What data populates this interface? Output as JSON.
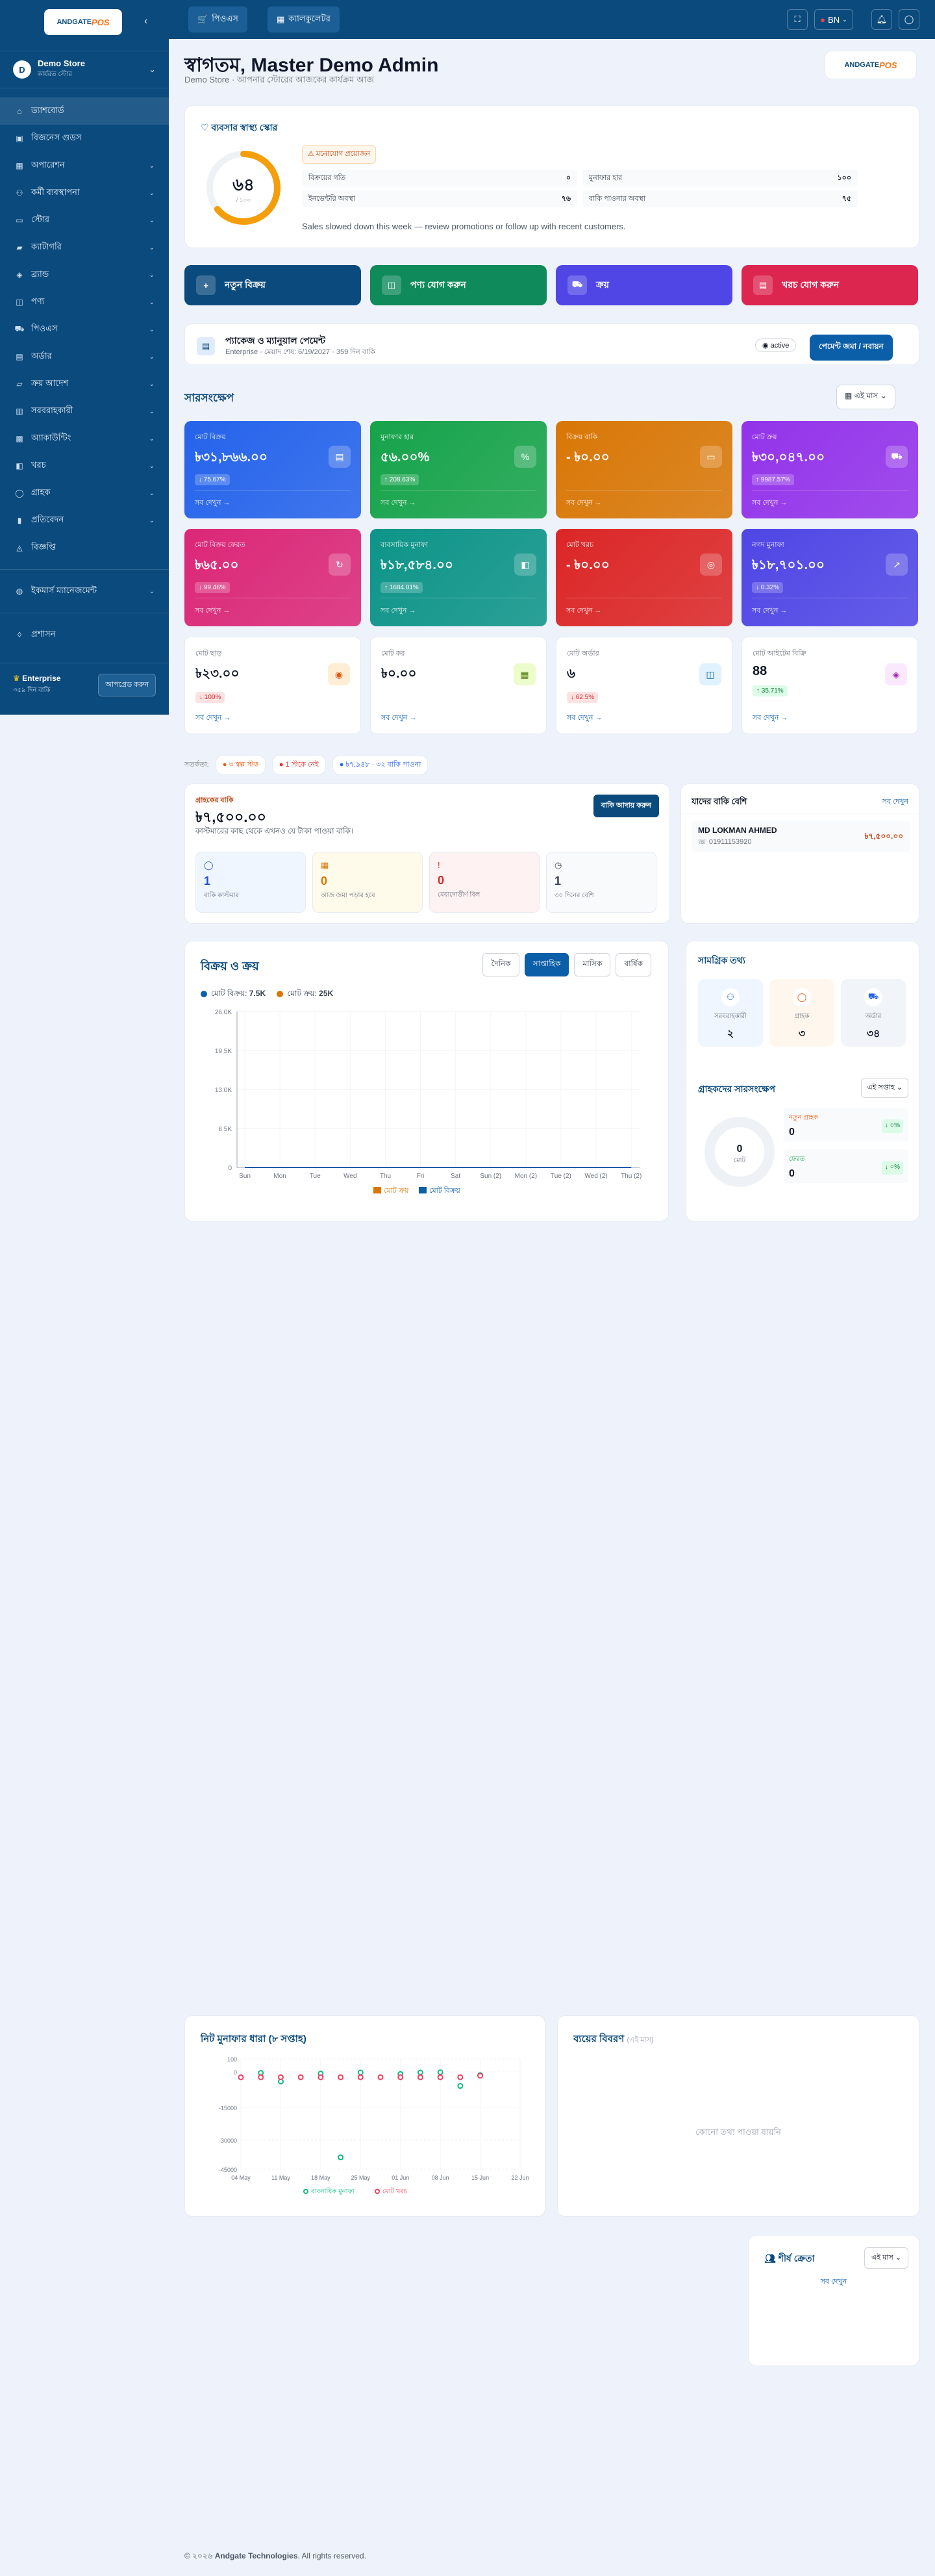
{
  "sidebar": {
    "logo_text": "ANDGATE",
    "logo_pos": "POS",
    "store_initial": "D",
    "store_name": "Demo Store",
    "store_role": "কার্যরত স্টোর",
    "items": [
      {
        "label": "ড্যাশবোর্ড",
        "icon": "home-icon"
      },
      {
        "label": "বিজনেস গুডস",
        "icon": "briefcase-icon"
      },
      {
        "label": "অপারেশন",
        "icon": "grid-icon"
      },
      {
        "label": "কর্মী ব্যবস্থাপনা",
        "icon": "users-icon"
      },
      {
        "label": "স্টোর",
        "icon": "store-icon"
      },
      {
        "label": "ক্যাটাগরি",
        "icon": "folder-icon"
      },
      {
        "label": "ব্র্যান্ড",
        "icon": "tag-icon"
      },
      {
        "label": "পণ্য",
        "icon": "box-icon"
      },
      {
        "label": "পিওএস",
        "icon": "cart-icon"
      },
      {
        "label": "অর্ডার",
        "icon": "receipt-icon"
      },
      {
        "label": "ক্রয় আদেশ",
        "icon": "truck-icon"
      },
      {
        "label": "সরবরাহকারী",
        "icon": "factory-icon"
      },
      {
        "label": "অ্যাকাউন্টিং",
        "icon": "calculator-icon"
      },
      {
        "label": "খরচ",
        "icon": "wallet-icon"
      },
      {
        "label": "গ্রাহক",
        "icon": "user-icon"
      },
      {
        "label": "প্রতিবেদন",
        "icon": "chart-icon"
      },
      {
        "label": "বিজ্ঞপ্তি",
        "icon": "bell-icon"
      },
      {
        "label": "ইকমার্স ম্যানেজমেন্ট",
        "icon": "globe-icon"
      },
      {
        "label": "প্রশাসন",
        "icon": "shield-icon"
      }
    ],
    "enterprise_title": "Enterprise",
    "enterprise_sub": "৩৫৯ দিন বাকি",
    "upgrade_label": "আপগ্রেড করুন"
  },
  "topbar": {
    "pos_label": "পিওএস",
    "calc_label": "ক্যালকুলেটর",
    "lang_label": "BN"
  },
  "header": {
    "welcome": "স্বাগতম, Master Demo Admin",
    "subtitle": "Demo Store · আপনার স্টোরের আজকের কার্যক্রম আজ",
    "brand_text": "ANDGATE",
    "brand_pos": "POS"
  },
  "health": {
    "title": "ব্যবসার স্বাস্থ্য স্কোর",
    "score": "৬৪",
    "score_sub": "/ ১০০",
    "score_value": 64,
    "badge": "মনোযোগ প্রয়োজন",
    "metrics": [
      {
        "label": "বিক্রয়ের গতি",
        "value": "০"
      },
      {
        "label": "মুনাফার হার",
        "value": "১০০"
      },
      {
        "label": "ইনভেন্টরি অবস্থা",
        "value": "৭৬"
      },
      {
        "label": "বাকি পাওনার অবস্থা",
        "value": "৭৫"
      }
    ],
    "note": "Sales slowed down this week — review promotions or follow up with recent customers."
  },
  "actions": [
    {
      "label": "নতুন বিক্রয়",
      "icon": "plus-icon",
      "color": "#0b4a7d"
    },
    {
      "label": "পণ্য যোগ করুন",
      "icon": "box-icon",
      "color": "#0f8a5a"
    },
    {
      "label": "ক্রয়",
      "icon": "cart-icon",
      "color": "#4f46e5"
    },
    {
      "label": "খরচ যোগ করুন",
      "icon": "receipt-icon",
      "color": "#dc2650"
    }
  ],
  "package": {
    "title": "প্যাকেজ ও ম্যানুয়াল পেমেন্ট",
    "sub": "Enterprise · মেয়াদ শেষ: 6/19/2027 · 359 দিন বাকি",
    "status": "active",
    "pay_label": "পেমেন্ট জমা / নবায়ন"
  },
  "overview": {
    "title": "সারসংক্ষেপ",
    "period": "এই মাস",
    "colored": [
      {
        "label": "মোট বিক্রয়",
        "value": "৳৩১,৮৬৬.০০",
        "chip": "↓ 75.67%",
        "more": "সব দেখুন →",
        "color": "#2563eb",
        "icon": "doc-icon"
      },
      {
        "label": "মুনাফার হার",
        "value": "৫৬.০০%",
        "chip": "↑ 208.63%",
        "more": "সব দেখুন →",
        "color": "#16a34a",
        "icon": "percent-icon"
      },
      {
        "label": "বিক্রয় বাকি",
        "value": "- ৳০.০০",
        "chip": "",
        "more": "সব দেখুন →",
        "color": "#d97706",
        "icon": "card-icon"
      },
      {
        "label": "মোট ক্রয়",
        "value": "৳৩০,০৪৭.০০",
        "chip": "↑ 9987.57%",
        "more": "সব দেখুন →",
        "color": "#9333ea",
        "icon": "cart-icon"
      },
      {
        "label": "মোট বিক্রয় ফেরত",
        "value": "৳৬৫.০০",
        "chip": "↓ 99.46%",
        "more": "সব দেখুন →",
        "color": "#db2777",
        "icon": "refresh-icon"
      },
      {
        "label": "ব্যবসায়িক মুনাফা",
        "value": "৳১৮,৫৮৪.০০",
        "chip": "↑ 1684.01%",
        "more": "সব দেখুন →",
        "color": "#0d9488",
        "icon": "wallet-icon"
      },
      {
        "label": "মোট খরচ",
        "value": "- ৳০.০০",
        "chip": "",
        "more": "সব দেখুন →",
        "color": "#dc2626",
        "icon": "money-icon"
      },
      {
        "label": "নগদ মুনাফা",
        "value": "৳১৮,৭০১.০০",
        "chip": "↓ 0.32%",
        "more": "সব দেখুন →",
        "color": "#4f46e5",
        "icon": "trend-icon"
      }
    ],
    "white": [
      {
        "label": "মোট ছাড়",
        "value": "৳২৩.০০",
        "chip": "↓ 100%",
        "more": "সব দেখুন →",
        "chip_color": "#dc2626",
        "chip_bg": "#fee2e2",
        "icon": "discount-icon",
        "icon_bg": "#ffedd5",
        "icon_color": "#ea580c"
      },
      {
        "label": "মোট কর",
        "value": "৳০.০০",
        "chip": "",
        "more": "সব দেখুন →",
        "chip_color": "",
        "chip_bg": "",
        "icon": "calc-icon",
        "icon_bg": "#ecfccb",
        "icon_color": "#4d7c0f"
      },
      {
        "label": "মোট অর্ডার",
        "value": "৬",
        "chip": "↓ 62.5%",
        "more": "সব দেখুন →",
        "chip_color": "#dc2626",
        "chip_bg": "#fee2e2",
        "icon": "db-icon",
        "icon_bg": "#e0f2fe",
        "icon_color": "#0369a1"
      },
      {
        "label": "মোট আইটেম বিক্রি",
        "value": "88",
        "chip": "↑ 35.71%",
        "more": "সব দেখুন →",
        "chip_color": "#15803d",
        "chip_bg": "#dcfce7",
        "icon": "cube-icon",
        "icon_bg": "#fae8ff",
        "icon_color": "#a21caf"
      }
    ]
  },
  "alerts": {
    "label": "সতর্কতা:",
    "items": [
      {
        "text": "৩ স্বল্প স্টক",
        "color": "#ea580c"
      },
      {
        "text": "1 স্টকে নেই",
        "color": "#dc2626"
      },
      {
        "text": "৳৭,৯৪৮ · ৩২ বাকি পাওনা",
        "color": "#2563eb"
      }
    ]
  },
  "due": {
    "label": "গ্রাহকের বাকি",
    "amount": "৳৭,৫০০.০০",
    "desc": "কাস্টমারের কাছ থেকে এখনও যে টাকা পাওয়া বাকি।",
    "collect_label": "বাকি আদায় করুন",
    "boxes": [
      {
        "value": "1",
        "label": "বাকি কাস্টমার",
        "bg": "#eff6ff",
        "color": "#1d4ed8",
        "icon": "user-icon"
      },
      {
        "value": "0",
        "label": "আজ জমা পড়ার হবে",
        "bg": "#fffbeb",
        "color": "#d97706",
        "icon": "calendar-icon"
      },
      {
        "value": "0",
        "label": "মেয়াদোত্তীর্ণ বিল",
        "bg": "#fef2f2",
        "color": "#dc2626",
        "icon": "alert-icon"
      },
      {
        "value": "1",
        "label": "৩০ দিনের বেশি",
        "bg": "#f8fafc",
        "color": "#374151",
        "icon": "clock-icon"
      }
    ]
  },
  "top_due": {
    "title": "যাদের বাকি বেশি",
    "see_all": "সব দেখুন",
    "name": "MD LOKMAN AHMED",
    "phone": "01911153920",
    "amount": "৳৭,৫০০.০০"
  },
  "sales_chart": {
    "title": "বিক্রয় ও ক্রয়",
    "tabs": [
      "দৈনিক",
      "সাপ্তাহিক",
      "মাসিক",
      "বার্ষিক"
    ],
    "active_tab": 1,
    "total_sales_label": "মোট বিক্রয়:",
    "total_sales": "7.5K",
    "total_purchase_label": "মোট ক্রয়:",
    "total_purchase": "25K",
    "legend_purchase": "মোট ক্রয়",
    "legend_sales": "মোট বিক্রয়"
  },
  "quick": {
    "title": "সামগ্রিক তথ্য",
    "items": [
      {
        "label": "সরবরাহকারী",
        "value": "২",
        "bg": "#eff6ff",
        "icon": "users-icon",
        "color": "#2563eb"
      },
      {
        "label": "গ্রাহক",
        "value": "৩",
        "bg": "#fff7ed",
        "icon": "user-icon",
        "color": "#ea580c"
      },
      {
        "label": "অর্ডার",
        "value": "৩৪",
        "bg": "#f1f5f9",
        "icon": "cart-icon",
        "color": "#2563eb"
      }
    ],
    "cust_title": "গ্রাহকদের সারসংক্ষেপ",
    "cust_period": "এই সপ্তাহ",
    "donut_value": "0",
    "donut_label": "মোট",
    "new_label": "নতুন গ্রাহক",
    "new_value": "0",
    "new_chip": "↓ ০%",
    "ret_label": "ফেরত",
    "ret_value": "0",
    "ret_chip": "↓ ০%"
  },
  "chart_data": [
    {
      "type": "line",
      "title": "বিক্রয় ও ক্রয়",
      "x": [
        "Sun",
        "Mon",
        "Tue",
        "Wed",
        "Thu",
        "Fri",
        "Sat",
        "Sun (2)",
        "Mon (2)",
        "Tue (2)",
        "Wed (2)",
        "Thu (2)"
      ],
      "yticks": [
        "26.0K",
        "19.5K",
        "13.0K",
        "6.5K",
        "0"
      ],
      "ylim": [
        0,
        26000
      ],
      "series": [
        {
          "name": "মোট ক্রয়",
          "color": "#d97706",
          "values": [
            0,
            0,
            0,
            0,
            0,
            0,
            0,
            0,
            0,
            0,
            0,
            0
          ]
        },
        {
          "name": "মোট বিক্রয়",
          "color": "#0b5ea8",
          "values": [
            0,
            0,
            0,
            0,
            0,
            0,
            0,
            0,
            0,
            0,
            0,
            0
          ]
        }
      ],
      "legend": "bottom"
    },
    {
      "type": "scatter",
      "title": "নিট মুনাফার ধারা (৮ সপ্তাহ)",
      "x": [
        "04 May",
        "11 May",
        "18 May",
        "25 May",
        "01 Jun",
        "08 Jun",
        "15 Jun",
        "22 Jun"
      ],
      "yticks": [
        "100",
        "0",
        "-15000",
        "-30000",
        "-45000"
      ],
      "series": [
        {
          "name": "ব্যবসায়িক মুনাফা",
          "color": "#10b981",
          "points": [
            [
              0,
              2500
            ],
            [
              0.5,
              -500
            ],
            [
              1,
              -4500
            ],
            [
              1.5,
              2000
            ],
            [
              2,
              -800
            ],
            [
              2.5,
              -39500
            ],
            [
              3,
              -300
            ],
            [
              3.5,
              2800
            ],
            [
              4,
              -1000
            ],
            [
              4.5,
              -300
            ],
            [
              5,
              -200
            ],
            [
              5.5,
              -6500
            ],
            [
              6,
              -1500
            ]
          ]
        },
        {
          "name": "মোট খরচ",
          "color": "#f43f5e",
          "points": [
            [
              0,
              -2500
            ],
            [
              0.5,
              -2500
            ],
            [
              1,
              -2500
            ],
            [
              1.5,
              -2500
            ],
            [
              2,
              -2500
            ],
            [
              2.5,
              -2500
            ],
            [
              3,
              -2500
            ],
            [
              3.5,
              -2500
            ],
            [
              4,
              -2500
            ],
            [
              4.5,
              -2500
            ],
            [
              5,
              -2500
            ],
            [
              5.5,
              -2500
            ],
            [
              6,
              -1800
            ]
          ]
        }
      ],
      "legend": "bottom"
    }
  ],
  "profit_trend": {
    "title": "নিট মুনাফার ধারা (৮ সপ্তাহ)",
    "legend_profit": "ব্যবসায়িক মুনাফা",
    "legend_expense": "মোট খরচ"
  },
  "expense": {
    "title": "ব্যয়ের বিবরণ",
    "period": "(এই মাস)",
    "empty": "কোনো তথ্য পাওয়া যায়নি"
  },
  "top_products": {
    "title": "শীর্ষ ক্রেতা",
    "period": "এই মাস",
    "see_all": "সব দেখুন"
  },
  "footer": {
    "prefix": "© ২০২৬",
    "company": "Andgate Technologies",
    "suffix": ". All rights reserved."
  }
}
